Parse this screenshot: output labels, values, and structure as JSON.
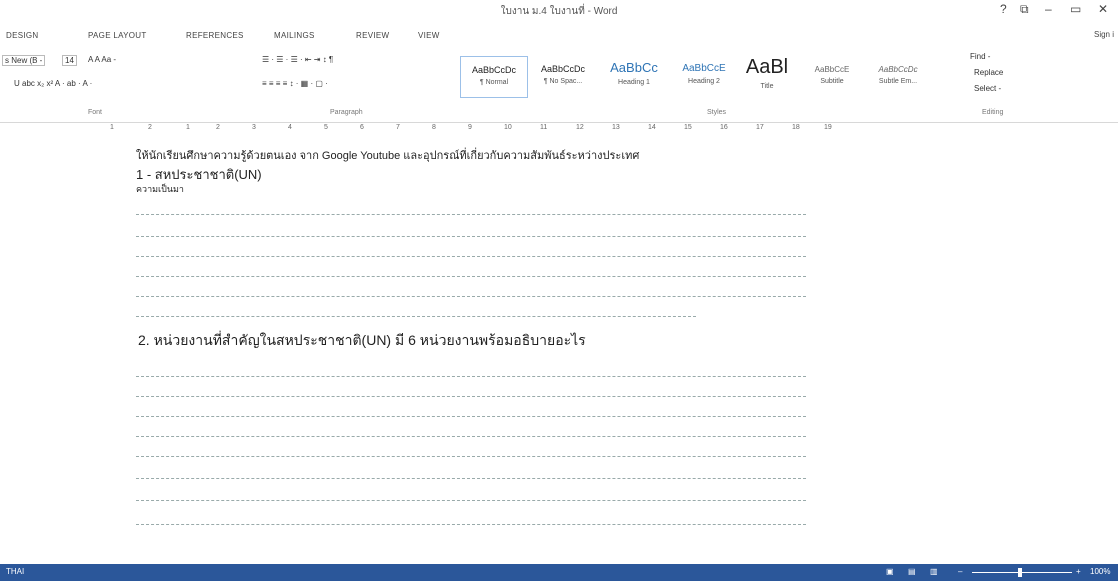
{
  "window": {
    "title": "ใบงาน ม.4 ใบงานที่ - Word",
    "controls": [
      "?",
      "⧉",
      "–",
      "▭",
      "✕"
    ],
    "sign_in": "Sign i"
  },
  "tabs": [
    "DESIGN",
    "PAGE LAYOUT",
    "REFERENCES",
    "MAILINGS",
    "REVIEW",
    "VIEW"
  ],
  "ribbon": {
    "font_name": "s New (B -",
    "font_size": "14",
    "font_row1": "A  A   Aa -",
    "font_row2": "U  abc  x₂  x²   A  ·  ab  ·  A  ·",
    "para_row1": "☰ · ☰ · ☰ ·   ⇤ ⇥   ↕   ¶",
    "para_row2": "≡  ≡  ≡  ≡   ↕ ·   ▦ ·  ▢ ·",
    "groups": {
      "font": "Font",
      "paragraph": "Paragraph",
      "styles": "Styles",
      "editing": "Editing"
    },
    "styles": [
      {
        "sample": "AaBbCcDc",
        "name": "¶ Normal"
      },
      {
        "sample": "AaBbCcDc",
        "name": "¶ No Spac..."
      },
      {
        "sample": "AaBbCc",
        "name": "Heading 1"
      },
      {
        "sample": "AaBbCcE",
        "name": "Heading 2"
      },
      {
        "sample": "AaBl",
        "name": "Title"
      },
      {
        "sample": "AaBbCcE",
        "name": "Subtitle"
      },
      {
        "sample": "AaBbCcDc",
        "name": "Subtle Em..."
      }
    ],
    "editing": {
      "find": "Find -",
      "replace": "Replace",
      "select": "Select -"
    }
  },
  "ruler": [
    "1",
    "2",
    "1",
    "2",
    "3",
    "4",
    "5",
    "6",
    "7",
    "8",
    "9",
    "10",
    "11",
    "12",
    "13",
    "14",
    "15",
    "16",
    "17",
    "18",
    "19"
  ],
  "document": {
    "intro": "ให้นักเรียนศึกษาความรู้ด้วยตนเอง จาก Google Youtube และอุปกรณ์ที่เกี่ยวกับความสัมพันธ์ระหว่างประเทศ",
    "section1_title": "1 - สหประชาชาติ(UN)",
    "section1_sub": "ความเป็นมา",
    "section2_title": "2. หน่วยงานที่สำคัญในสหประชาชาติ(UN)  มี 6 หน่วยงานพร้อมอธิบายอะไร"
  },
  "status": {
    "language": "THAI",
    "zoom": "100%"
  }
}
